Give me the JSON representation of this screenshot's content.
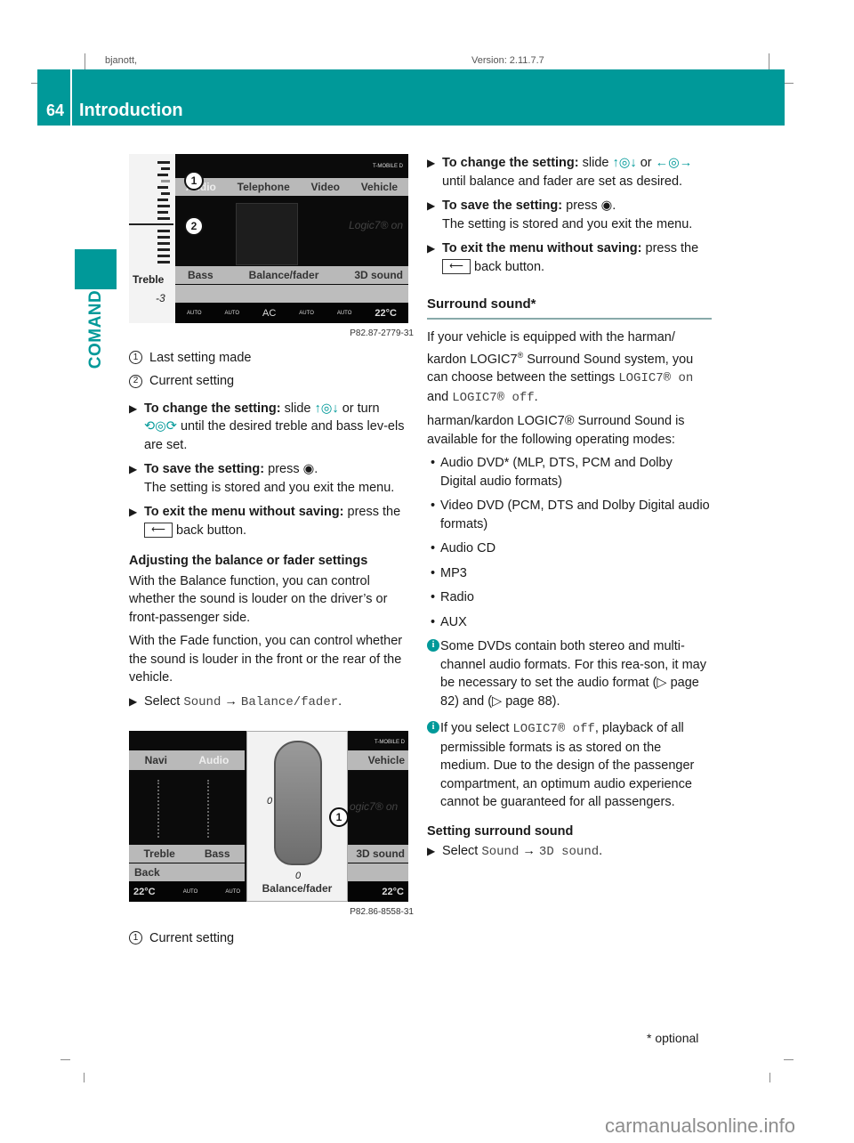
{
  "meta": {
    "left": "bjanott,",
    "center": "Version: 2.11.7.7"
  },
  "header": {
    "page_number": "64",
    "title": "Introduction",
    "section_tab": "COMAND"
  },
  "colors": {
    "accent": "#009999"
  },
  "figure1": {
    "id": "P82.87-2779-31",
    "signal_label": "T-MOBILE D",
    "tabs": [
      "Audio",
      "Telephone",
      "Video",
      "Vehicle"
    ],
    "status_text": "Logic7® on",
    "bottom_menu": [
      "Bass",
      "Balance/fader",
      "3D sound"
    ],
    "side_label": "Treble",
    "side_value": "-3",
    "climate": [
      "AUTO",
      "AUTO",
      "AC",
      "AUTO",
      "AUTO",
      "22°C"
    ],
    "callouts": [
      "1",
      "2"
    ]
  },
  "legend1": [
    {
      "num": "1",
      "text": "Last setting made"
    },
    {
      "num": "2",
      "text": "Current setting"
    }
  ],
  "steps_left": {
    "change_bold": "To change the setting:",
    "change_text1": "slide",
    "change_text2": "or turn",
    "change_text3": "until the desired treble and bass lev-els are set.",
    "save_bold": "To save the setting:",
    "save_text": "press",
    "save_note": "The setting is stored and you exit the menu.",
    "exit_bold": "To exit the menu without saving:",
    "exit_text1": "press the",
    "exit_text2": "back button."
  },
  "balance_section": {
    "heading": "Adjusting the balance or fader settings",
    "para1": "With the Balance function, you can control whether the sound is louder on the driver’s or front-passenger side.",
    "para2": "With the Fade function, you can control whether the sound is louder in the front or the rear of the vehicle.",
    "select_label": "Select",
    "menu_path_1": "Sound",
    "arrow": "→",
    "menu_path_2": "Balance/fader"
  },
  "figure2": {
    "id": "P82.86-8558-31",
    "signal_label": "T-MOBILE D",
    "left_tabs": [
      "Navi",
      "Audio"
    ],
    "right_tab": "Vehicle",
    "status_text": "ogic7® on",
    "left_menu": [
      "Treble",
      "Bass"
    ],
    "back_label": "Back",
    "right_menu": "3D sound",
    "balance_value": "0",
    "fader_value": "0",
    "center_label": "Balance/fader",
    "temp_left": "22°C",
    "temp_right": "22°C",
    "climate_auto": "AUTO",
    "callout": "1"
  },
  "legend2": [
    {
      "num": "1",
      "text": "Current setting"
    }
  ],
  "steps_right": {
    "change_bold": "To change the setting:",
    "change_text1": "slide",
    "change_text2": "or",
    "change_text3": "until balance and fader are set as desired.",
    "save_bold": "To save the setting:",
    "save_text": "press",
    "save_note": "The setting is stored and you exit the menu.",
    "exit_bold": "To exit the menu without saving:",
    "exit_text1": "press the",
    "exit_text2": "back button."
  },
  "surround": {
    "title": "Surround sound*",
    "intro_1": "If your vehicle is equipped with the harman/ kardon LOGIC7",
    "intro_2": " Surround Sound system, you can choose between the settings ",
    "setting_on": "LOGIC7® on",
    "and": " and ",
    "setting_off": "LOGIC7® off",
    "para2": "harman/kardon LOGIC7® Surround Sound is available for the following operating modes:",
    "modes": [
      "Audio DVD* (MLP, DTS, PCM and Dolby Digital audio formats)",
      "Video DVD (PCM, DTS and Dolby Digital audio formats)",
      "Audio CD",
      "MP3",
      "Radio",
      "AUX"
    ],
    "info1": "Some DVDs contain both stereo and multi-channel audio formats. For this rea-son, it may be necessary to set the audio format (▷ page 82) and (▷ page 88).",
    "info2_pre": "If you select ",
    "info2_code": "LOGIC7® off",
    "info2_post": ", playback of all permissible formats is as stored on the medium. Due to the design of the passenger compartment, an optimum audio experience cannot be guaranteed for all passengers.",
    "setting_heading": "Setting surround sound",
    "select_label": "Select",
    "menu_path_1": "Sound",
    "arrow": "→",
    "menu_path_2": "3D sound"
  },
  "footer": {
    "footnote": "* optional",
    "watermark": "carmanualsonline.info"
  }
}
